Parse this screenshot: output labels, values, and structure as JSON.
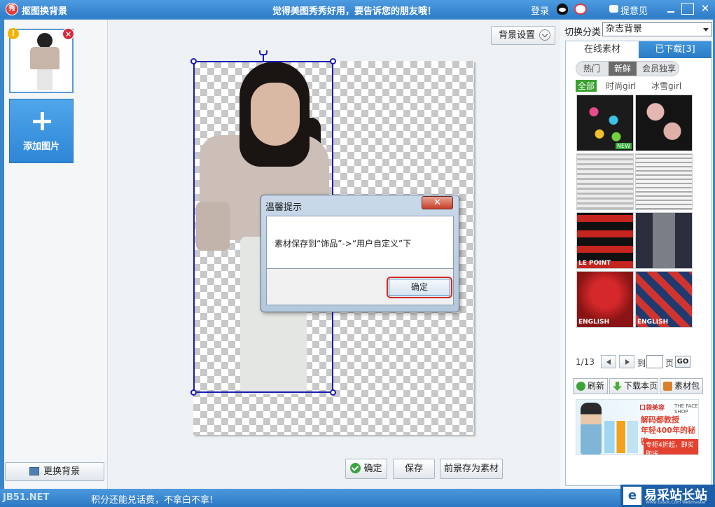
{
  "titlebar": {
    "logo_text": "秀",
    "app_title": "抠图换背景",
    "slogan": "觉得美图秀秀好用，要告诉您的朋友哦！",
    "login": "登录",
    "feedback": "提意见",
    "close_glyph": "✕"
  },
  "left": {
    "warn_glyph": "!",
    "remove_glyph": "✕",
    "add_label": "添加图片",
    "change_bg_label": "更换背景"
  },
  "canvas": {
    "bg_settings_label": "背景设置"
  },
  "dialog": {
    "title": "温馨提示",
    "close_glyph": "✕",
    "message": "素材保存到“饰品”->“用户自定义”下",
    "ok_label": "确定"
  },
  "bottom": {
    "confirm_label": "确定",
    "save_label": "保存",
    "save_fg_label": "前景存为素材"
  },
  "right": {
    "category_label": "切换分类",
    "category_value": "杂志背景",
    "tabs": [
      {
        "label": "在线素材"
      },
      {
        "label": "已下载[3]"
      }
    ],
    "pills": [
      "热门",
      "新鲜",
      "会员独享"
    ],
    "subfilters": [
      "全部",
      "时尚girl",
      "冰雪girl"
    ],
    "tiles": [
      {
        "text": "",
        "badge": "NEW"
      },
      {
        "text": ""
      },
      {
        "text": ""
      },
      {
        "text": ""
      },
      {
        "text": "LE POINT"
      },
      {
        "text": ""
      },
      {
        "text": "ENGLISH"
      },
      {
        "text": "ENGLISH"
      }
    ],
    "pager": {
      "current": "1/13",
      "to": "到",
      "page": "页",
      "go": "GO"
    },
    "actions": {
      "refresh": "刷新",
      "download": "下载本页",
      "pack": "素材包"
    },
    "ad": {
      "brand": "口袋美容",
      "brand2": "THE FACE SHOP",
      "line1": "解码都教授",
      "line2": "年轻400年的秘密",
      "line3": "专柜4折起，即买即送"
    }
  },
  "status": {
    "site": "JB51.NET",
    "text": "积分还能兑话费，不拿白不拿!"
  },
  "watermark": {
    "logo": "e",
    "name": "易采站长站",
    "sub": "Www.Easck.Com Webmaster"
  }
}
